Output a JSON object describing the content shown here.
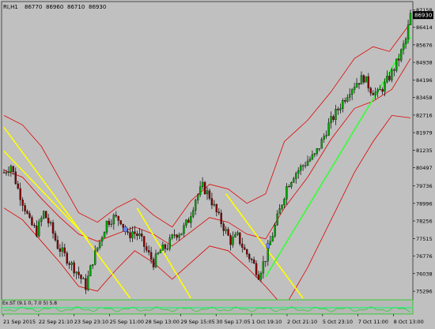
{
  "header": {
    "symbol": "RI,H1",
    "open": "86770",
    "high": "86960",
    "low": "86710",
    "close": "86930"
  },
  "indicator_label": "Ex.ST (9.1 0, 7.0 5) 5.8",
  "current_price_label": "86930",
  "colors": {
    "background": "#c0c0c0",
    "candle_up": "#00aa00",
    "candle_down": "#8b0000",
    "bollinger": "#e00000",
    "trend_yellow": "#ffff00",
    "trend_green": "#33ff33",
    "indicator": "#33cc33",
    "axis_text": "#000000"
  },
  "chart_data": {
    "type": "candlestick",
    "timeframe": "H1",
    "ylim": [
      75000,
      87500
    ],
    "y_ticks": [
      87158,
      86414,
      85676,
      84938,
      84196,
      83458,
      82716,
      81979,
      81235,
      80497,
      79736,
      78996,
      78256,
      77515,
      76776,
      76038,
      75296
    ],
    "x_tick_labels": [
      "21 Sep 2015",
      "22 Sep 21:10",
      "23 Sep 23:10",
      "25 Sep 11:00",
      "28 Sep 13:00",
      "29 Sep 15:05",
      "30 Sep 17:05",
      "1 Oct 19:10",
      "2 Oct 21:10",
      "5 Oct 23:10",
      "7 Oct 11:00",
      "8 Oct 13:00"
    ],
    "price_path": [
      [
        0,
        80300
      ],
      [
        3,
        80600
      ],
      [
        6,
        79600
      ],
      [
        9,
        78800
      ],
      [
        11,
        78200
      ],
      [
        14,
        77800
      ],
      [
        17,
        78600
      ],
      [
        20,
        78000
      ],
      [
        23,
        77200
      ],
      [
        26,
        76800
      ],
      [
        29,
        76400
      ],
      [
        32,
        76000
      ],
      [
        35,
        75500
      ],
      [
        38,
        76600
      ],
      [
        41,
        77400
      ],
      [
        44,
        78200
      ],
      [
        47,
        78400
      ],
      [
        50,
        78300
      ],
      [
        53,
        77600
      ],
      [
        55,
        77800
      ],
      [
        58,
        77600
      ],
      [
        61,
        77000
      ],
      [
        64,
        76500
      ],
      [
        67,
        77000
      ],
      [
        70,
        77200
      ],
      [
        73,
        77700
      ],
      [
        76,
        77800
      ],
      [
        79,
        78300
      ],
      [
        82,
        79200
      ],
      [
        85,
        79700
      ],
      [
        88,
        79300
      ],
      [
        91,
        78600
      ],
      [
        94,
        78000
      ],
      [
        97,
        77400
      ],
      [
        100,
        77600
      ],
      [
        103,
        77000
      ],
      [
        106,
        76600
      ],
      [
        109,
        76000
      ],
      [
        112,
        76700
      ],
      [
        115,
        77700
      ],
      [
        118,
        78700
      ],
      [
        121,
        79700
      ],
      [
        124,
        80200
      ],
      [
        127,
        80500
      ],
      [
        130,
        80800
      ],
      [
        133,
        81000
      ],
      [
        136,
        81600
      ],
      [
        139,
        82300
      ],
      [
        142,
        82800
      ],
      [
        145,
        83300
      ],
      [
        148,
        83800
      ],
      [
        151,
        84100
      ],
      [
        154,
        84300
      ],
      [
        157,
        83800
      ],
      [
        160,
        83600
      ],
      [
        163,
        84000
      ],
      [
        166,
        84500
      ],
      [
        169,
        85100
      ],
      [
        172,
        85900
      ],
      [
        174,
        86930
      ]
    ],
    "bollinger_bands": {
      "upper": [
        [
          0,
          82700
        ],
        [
          8,
          82300
        ],
        [
          16,
          81400
        ],
        [
          24,
          80000
        ],
        [
          32,
          78600
        ],
        [
          40,
          78200
        ],
        [
          48,
          78800
        ],
        [
          56,
          79200
        ],
        [
          64,
          78500
        ],
        [
          72,
          78000
        ],
        [
          80,
          79100
        ],
        [
          88,
          79800
        ],
        [
          96,
          79600
        ],
        [
          104,
          79000
        ],
        [
          112,
          79400
        ],
        [
          120,
          81600
        ],
        [
          130,
          82500
        ],
        [
          140,
          83700
        ],
        [
          150,
          85100
        ],
        [
          158,
          85600
        ],
        [
          165,
          85400
        ],
        [
          174,
          86600
        ]
      ],
      "middle": [
        [
          0,
          80400
        ],
        [
          8,
          80100
        ],
        [
          16,
          79200
        ],
        [
          24,
          78400
        ],
        [
          32,
          77700
        ],
        [
          40,
          77400
        ],
        [
          48,
          77700
        ],
        [
          56,
          78000
        ],
        [
          64,
          77700
        ],
        [
          72,
          77200
        ],
        [
          80,
          77800
        ],
        [
          88,
          78400
        ],
        [
          96,
          78200
        ],
        [
          104,
          77700
        ],
        [
          112,
          77500
        ],
        [
          120,
          78800
        ],
        [
          130,
          80100
        ],
        [
          140,
          81700
        ],
        [
          150,
          83000
        ],
        [
          158,
          83300
        ],
        [
          166,
          83800
        ],
        [
          174,
          85100
        ]
      ],
      "lower": [
        [
          0,
          78800
        ],
        [
          8,
          78300
        ],
        [
          16,
          77400
        ],
        [
          24,
          76500
        ],
        [
          32,
          75500
        ],
        [
          40,
          75300
        ],
        [
          48,
          76200
        ],
        [
          56,
          77000
        ],
        [
          64,
          76500
        ],
        [
          72,
          75800
        ],
        [
          80,
          76500
        ],
        [
          88,
          77200
        ],
        [
          96,
          77000
        ],
        [
          104,
          76300
        ],
        [
          112,
          75500
        ],
        [
          120,
          74600
        ],
        [
          130,
          76300
        ],
        [
          140,
          78300
        ],
        [
          150,
          80300
        ],
        [
          158,
          81600
        ],
        [
          166,
          82700
        ],
        [
          174,
          82600
        ]
      ]
    },
    "trend_lines": [
      {
        "color": "yellow",
        "from": [
          0,
          82200
        ],
        "to": [
          54,
          75000
        ]
      },
      {
        "color": "yellow",
        "from": [
          57,
          78800
        ],
        "to": [
          80,
          75000
        ]
      },
      {
        "color": "yellow",
        "from": [
          95,
          79400
        ],
        "to": [
          128,
          75000
        ]
      },
      {
        "color": "yellow",
        "from": [
          0,
          81200
        ],
        "to": [
          36,
          77500
        ]
      },
      {
        "color": "green",
        "from": [
          112,
          75900
        ],
        "to": [
          174,
          86000
        ]
      }
    ],
    "grid": false
  }
}
